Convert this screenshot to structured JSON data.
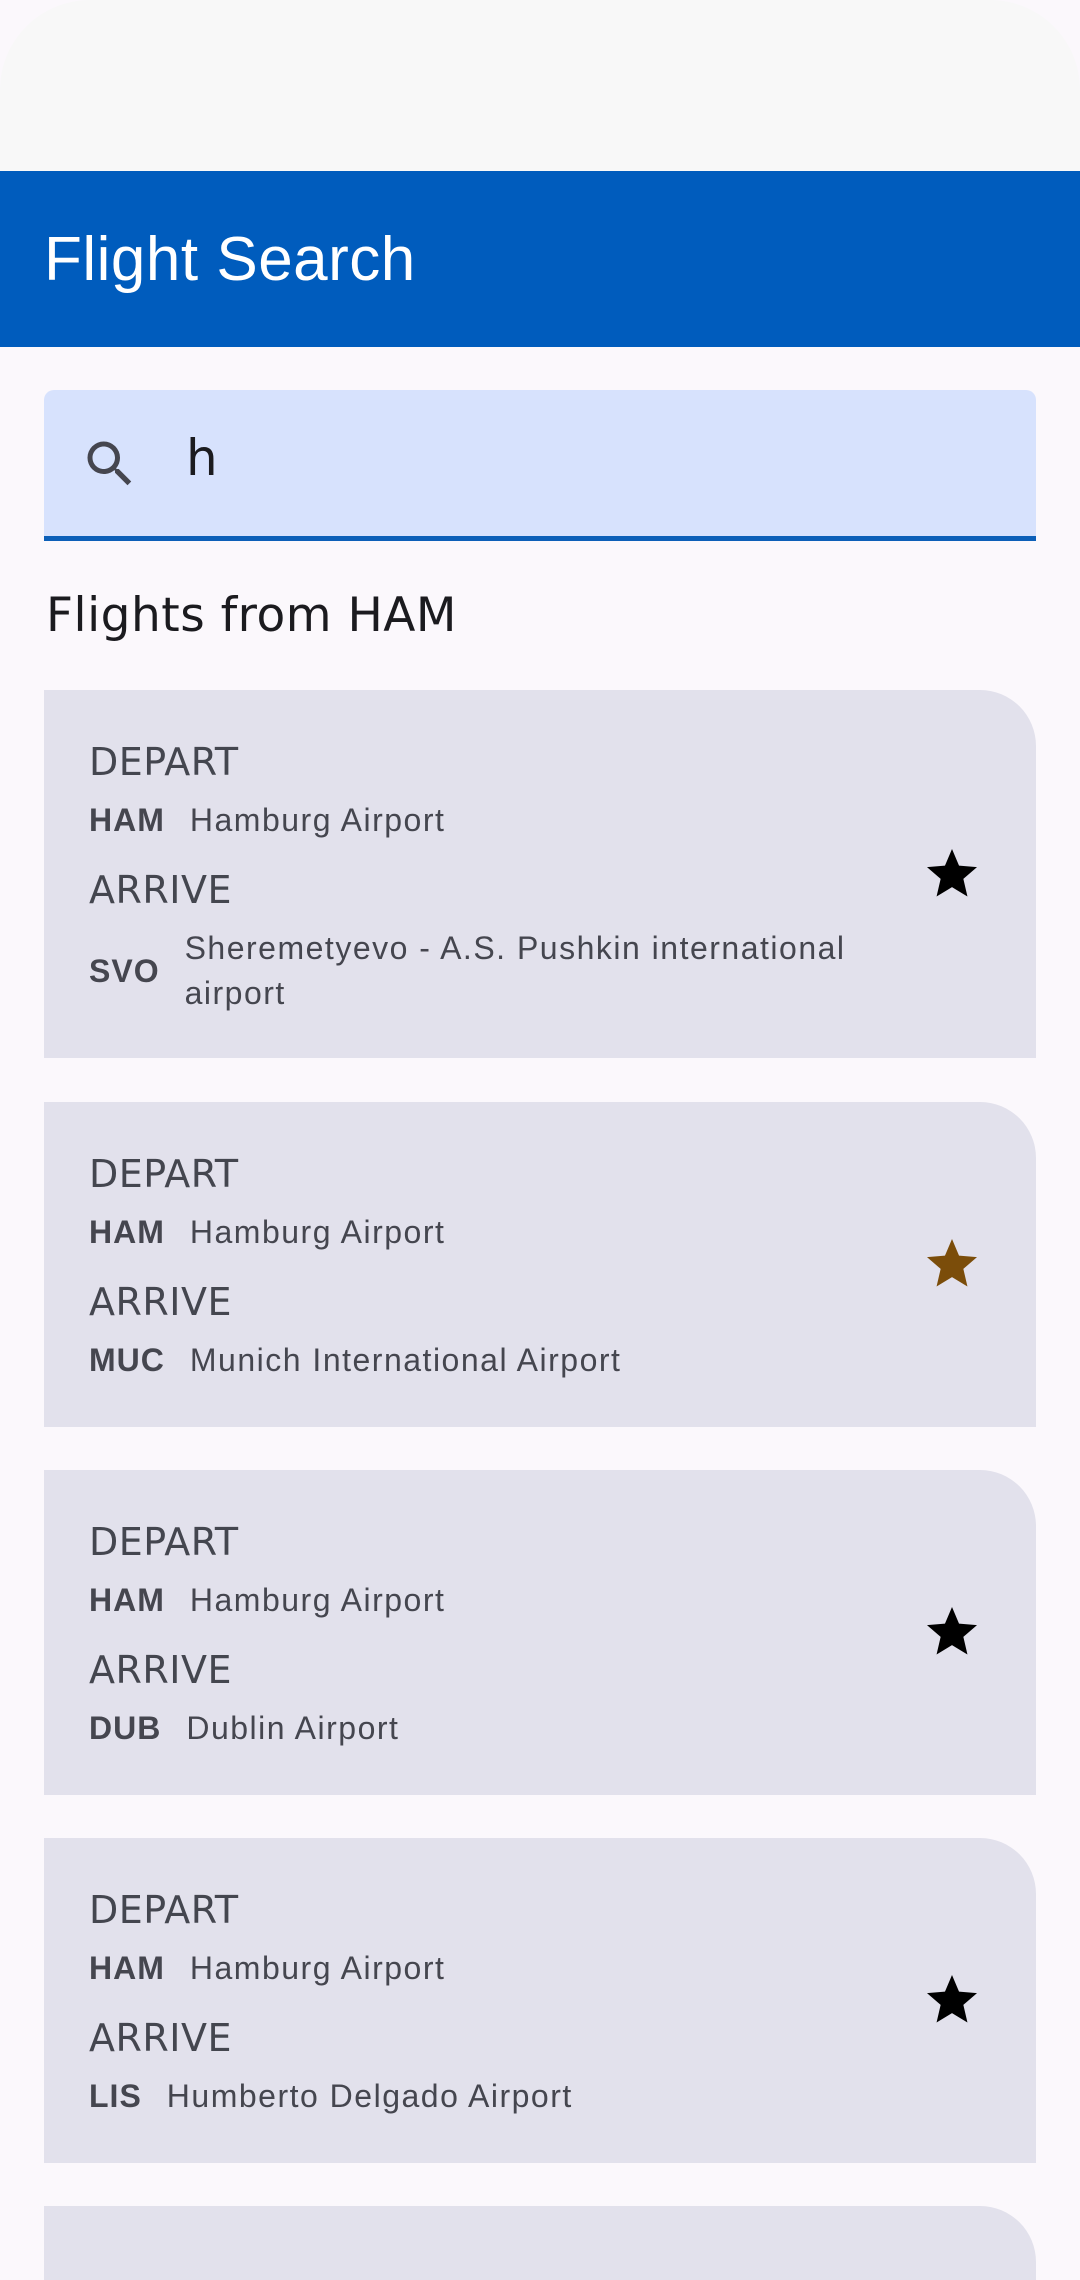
{
  "app": {
    "title": "Flight Search"
  },
  "search": {
    "value": "h",
    "icon": "search-icon"
  },
  "section": {
    "title": "Flights from HAM"
  },
  "colors": {
    "app_bar": "#005cbd",
    "search_bg": "#d7e2fd",
    "card_bg": "#e2e1ec",
    "star_default": "#000000",
    "star_favorite": "#7b4d0a"
  },
  "flights": [
    {
      "depart_label": "DEPART",
      "depart_code": "HAM",
      "depart_name": "Hamburg Airport",
      "arrive_label": "ARRIVE",
      "arrive_code": "SVO",
      "arrive_name": "Sheremetyevo - A.S. Pushkin international airport",
      "favorite": false
    },
    {
      "depart_label": "DEPART",
      "depart_code": "HAM",
      "depart_name": "Hamburg Airport",
      "arrive_label": "ARRIVE",
      "arrive_code": "MUC",
      "arrive_name": "Munich International Airport",
      "favorite": true
    },
    {
      "depart_label": "DEPART",
      "depart_code": "HAM",
      "depart_name": "Hamburg Airport",
      "arrive_label": "ARRIVE",
      "arrive_code": "DUB",
      "arrive_name": "Dublin Airport",
      "favorite": false
    },
    {
      "depart_label": "DEPART",
      "depart_code": "HAM",
      "depart_name": "Hamburg Airport",
      "arrive_label": "ARRIVE",
      "arrive_code": "LIS",
      "arrive_name": "Humberto Delgado Airport",
      "favorite": false
    }
  ]
}
